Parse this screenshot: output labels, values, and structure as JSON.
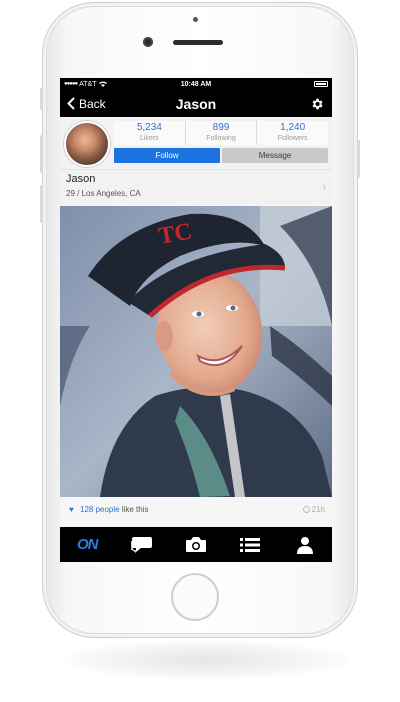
{
  "status_bar": {
    "carrier": "AT&T",
    "time": "10:48 AM"
  },
  "nav": {
    "back_label": "Back",
    "title": "Jason"
  },
  "profile": {
    "stats": [
      {
        "value": "5,234",
        "label": "Likers"
      },
      {
        "value": "899",
        "label": "Following"
      },
      {
        "value": "1,240",
        "label": "Followers"
      }
    ],
    "follow_label": "Follow",
    "message_label": "Message",
    "name": "Jason",
    "meta": "29 / Los Angeles, CA"
  },
  "post": {
    "likes_link": "128 people",
    "likes_suffix": " like this",
    "time_ago": "21h"
  },
  "tab_bar": {
    "logo_label": "ON"
  },
  "colors": {
    "accent": "#1a73de",
    "bar": "#000000",
    "cap_logo": "#c0282d"
  },
  "icons": [
    "back-chevron-icon",
    "gear-icon",
    "heart-icon",
    "clock-icon",
    "chat-icon",
    "camera-icon",
    "list-icon",
    "person-icon"
  ]
}
